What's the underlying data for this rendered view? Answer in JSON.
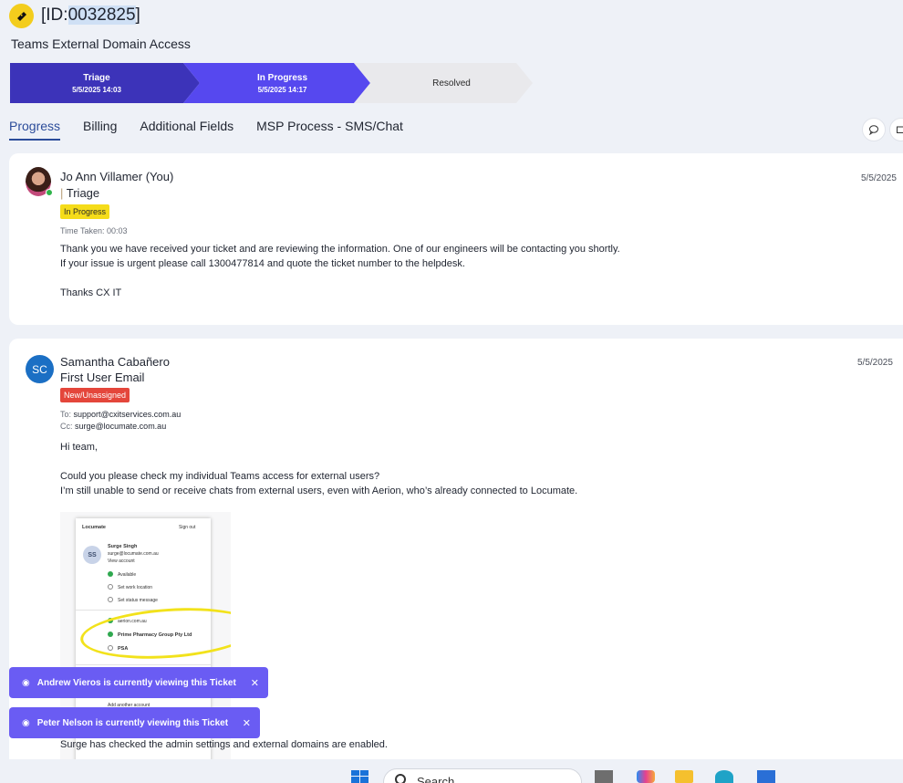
{
  "ticket": {
    "id_prefix": "[ID:",
    "id_number": "0032825",
    "id_suffix": "]",
    "title": "Teams External Domain Access"
  },
  "stages": [
    {
      "label": "Triage",
      "date": "5/5/2025 14:03"
    },
    {
      "label": "In Progress",
      "date": "5/5/2025 14:17"
    },
    {
      "label": "Resolved",
      "date": ""
    }
  ],
  "tabs": [
    "Progress",
    "Billing",
    "Additional Fields",
    "MSP Process - SMS/Chat"
  ],
  "entries": [
    {
      "author": "Jo Ann Villamer (You)",
      "stage": "Triage",
      "status": "In Progress",
      "time_taken": "Time Taken: 00:03",
      "date": "5/5/2025",
      "body": "Thank you we have received your ticket and are reviewing the information. One of our engineers will be contacting you shortly.\nIf your issue is urgent please call 1300477814 and quote the ticket number to the helpdesk.\n\nThanks CX IT"
    },
    {
      "author": "Samantha Cabañero",
      "initials": "SC",
      "subject": "First User Email",
      "status": "New/Unassigned",
      "to_label": "To:",
      "to": "support@cxitservices.com.au",
      "cc_label": "Cc:",
      "cc": "surge@locumate.com.au",
      "date": "5/5/2025",
      "greeting": "Hi team,",
      "body": "Could you please check my individual Teams access for external users?\nI’m still unable to send or receive chats from external users, even with Aerion, who’s already connected to Locumate.",
      "footer": "Surge has checked the admin settings and external domains are enabled."
    }
  ],
  "screenshot": {
    "org": "Locumate",
    "sign_out": "Sign out",
    "initials": "SS",
    "name": "Surge Singh",
    "email": "surge@locumate.com.au",
    "view_account": "View account",
    "status": "Available",
    "work_location": "Set work location",
    "status_message": "Set status message",
    "orgs": [
      "aerion.com.au",
      "Prime Pharmacy Group Pty Ltd",
      "PSA"
    ],
    "add_account": "Add another account"
  },
  "toasts": [
    "Andrew Vieros is currently viewing this Ticket",
    "Peter Nelson is currently viewing this Ticket"
  ],
  "taskbar": {
    "search_label": "Search"
  },
  "colors": {
    "stage_done": "#3c33b9",
    "stage_active": "#5648ef",
    "badge_inprogress": "#f5dc1a",
    "badge_new": "#e4463b",
    "toast": "#6a5cf3"
  }
}
